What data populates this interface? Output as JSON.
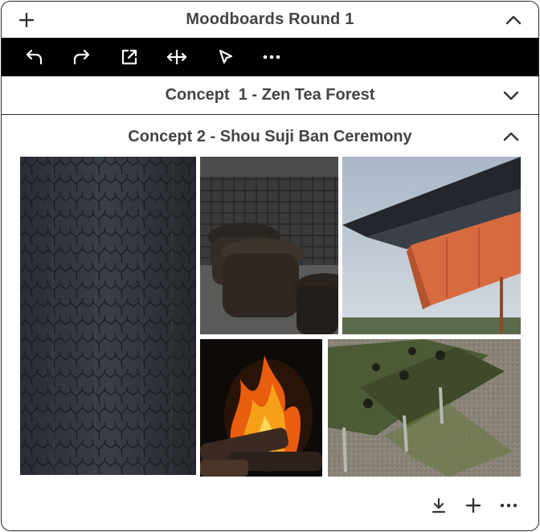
{
  "board": {
    "title": "Moodboards Round 1",
    "add_icon": "plus-icon",
    "collapse_icon": "chevron-up-icon"
  },
  "toolbar": {
    "items": [
      {
        "name": "undo",
        "icon": "undo-icon"
      },
      {
        "name": "redo",
        "icon": "redo-icon"
      },
      {
        "name": "open-external",
        "icon": "external-link-icon"
      },
      {
        "name": "move",
        "icon": "move-horizontal-icon"
      },
      {
        "name": "select",
        "icon": "cursor-pointer-icon"
      },
      {
        "name": "more",
        "icon": "more-icon"
      }
    ]
  },
  "concepts": [
    {
      "title": "Concept  1 - Zen Tea Forest",
      "expanded": false
    },
    {
      "title": "Concept 2 - Shou Suji Ban Ceremony",
      "expanded": true
    }
  ],
  "images": [
    {
      "name": "charred-wood-texture"
    },
    {
      "name": "dark-stone-stools"
    },
    {
      "name": "orange-canopy-building"
    },
    {
      "name": "campfire"
    },
    {
      "name": "green-glass-bench"
    }
  ],
  "footer": {
    "actions": [
      {
        "name": "download",
        "icon": "download-icon"
      },
      {
        "name": "add",
        "icon": "plus-icon"
      },
      {
        "name": "more",
        "icon": "more-icon"
      }
    ]
  },
  "colors": {
    "toolbar_bg": "#000000",
    "text": "#444444",
    "border": "#2a2a2a"
  }
}
